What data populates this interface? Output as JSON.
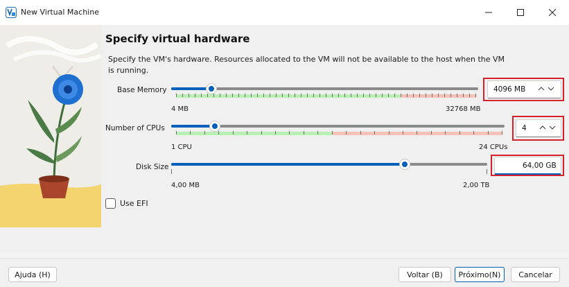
{
  "window": {
    "title": "New Virtual Machine",
    "minimize_glyph": "—",
    "maximize_glyph": "☐",
    "close_glyph": "✕"
  },
  "page": {
    "heading": "Specify virtual hardware",
    "description": "Specify the VM's hardware. Resources allocated to the VM will not be available to the host when the VM is running."
  },
  "base_memory": {
    "label": "Base Memory",
    "value": "4096 MB",
    "min_label": "4 MB",
    "max_label": "32768 MB",
    "fraction": 0.13,
    "spin_arrows": "^ v"
  },
  "cpus": {
    "label": "Number of CPUs",
    "value": "4",
    "min_label": "1 CPU",
    "max_label": "24 CPUs",
    "fraction": 0.13,
    "spin_arrows": "^ v"
  },
  "disk": {
    "label": "Disk Size",
    "value": "64,00 GB",
    "min_label": "4,00 MB",
    "max_label": "2,00 TB",
    "fraction": 0.74
  },
  "efi": {
    "label": "Use EFI",
    "checked": false
  },
  "footer": {
    "help": "Ajuda (H)",
    "back": "Voltar (B)",
    "next": "Próximo(N)",
    "cancel": "Cancelar"
  },
  "colors": {
    "accent": "#005fb8",
    "highlight_box": "#d6202a",
    "zone_ok": "#b9f0b4",
    "zone_warn": "#f6c2b8"
  }
}
